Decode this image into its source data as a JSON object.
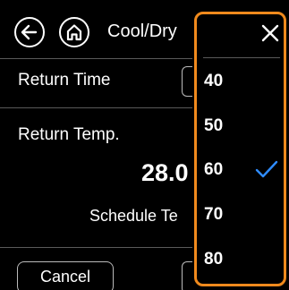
{
  "header": {
    "back_icon": "arrow-left-icon",
    "home_icon": "home-icon",
    "title": "Cool/Dry"
  },
  "settings": {
    "return_time_label": "Return Time",
    "return_temp_label": "Return Temp.",
    "return_temp_value": "28.0",
    "schedule_label": "Schedule Te"
  },
  "footer": {
    "cancel_label": "Cancel"
  },
  "dropdown": {
    "close_icon": "close-icon",
    "options": [
      "40",
      "50",
      "60",
      "70",
      "80"
    ],
    "selected": "60",
    "selected_icon": "checkmark-icon",
    "highlight_color": "#f08a1d",
    "check_color": "#2f8cff"
  }
}
